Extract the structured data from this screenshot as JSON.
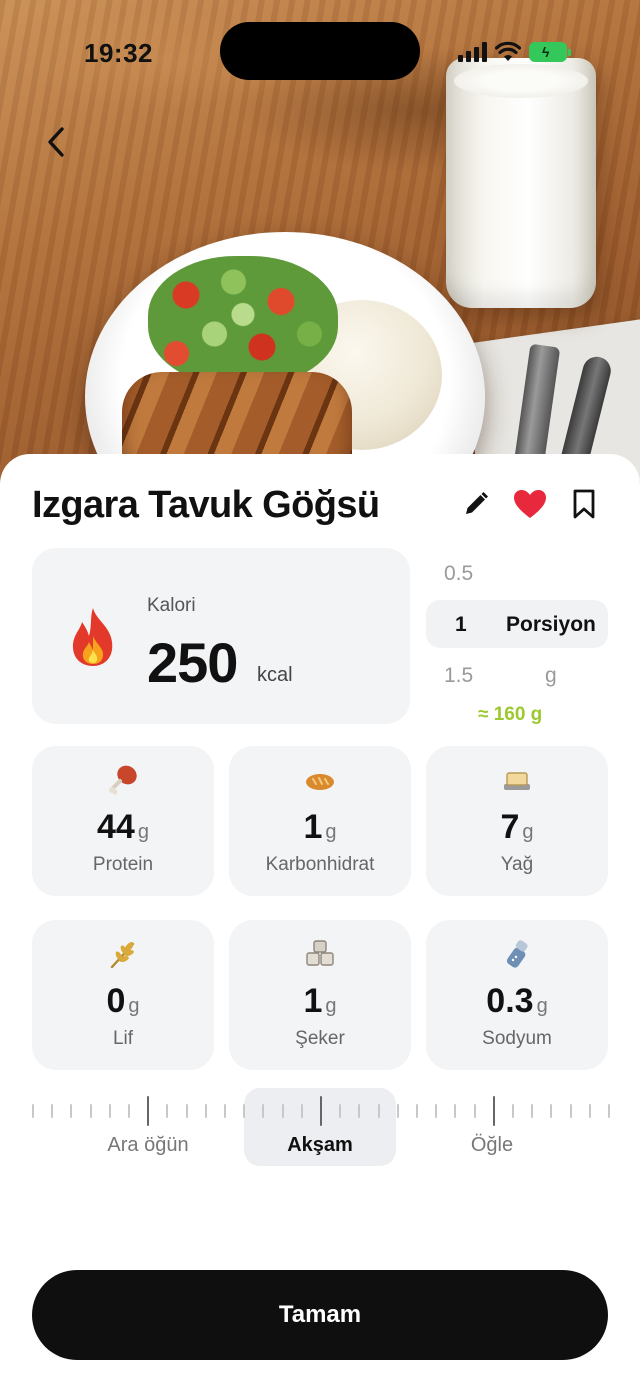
{
  "status_bar": {
    "time": "19:32"
  },
  "food": {
    "title": "Izgara Tavuk Göğsü"
  },
  "calories": {
    "label": "Kalori",
    "value": "250",
    "unit": "kcal"
  },
  "portion": {
    "options_above": [
      "0.5"
    ],
    "selected_amount": "1",
    "selected_unit": "Porsiyon",
    "options_below": [
      "1.5"
    ],
    "unit_below": "g",
    "equivalent": "≈ 160 g"
  },
  "nutrients": [
    {
      "icon": "drumstick-icon",
      "value": "44",
      "unit": "g",
      "label": "Protein"
    },
    {
      "icon": "bread-icon",
      "value": "1",
      "unit": "g",
      "label": "Karbonhidrat"
    },
    {
      "icon": "butter-icon",
      "value": "7",
      "unit": "g",
      "label": "Yağ"
    },
    {
      "icon": "wheat-icon",
      "value": "0",
      "unit": "g",
      "label": "Lif"
    },
    {
      "icon": "sugar-cubes-icon",
      "value": "1",
      "unit": "g",
      "label": "Şeker"
    },
    {
      "icon": "salt-shaker-icon",
      "value": "0.3",
      "unit": "g",
      "label": "Sodyum"
    }
  ],
  "meals": {
    "items": [
      "Ara öğün",
      "Akşam",
      "Öğle"
    ],
    "selected": "Akşam"
  },
  "done_button": {
    "label": "Tamam"
  },
  "colors": {
    "accent_green": "#9cc92e",
    "heart_red": "#e8283c",
    "battery_green": "#34c759",
    "button_dark": "#0f0f0f"
  }
}
